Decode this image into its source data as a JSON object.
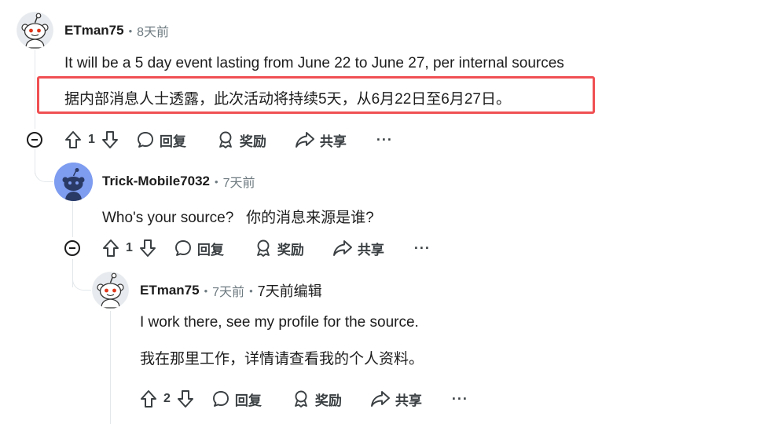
{
  "comments": [
    {
      "username": "ETman75",
      "time": "8天前",
      "text_en": "It will be a 5 day event lasting from June 22 to June 27, per internal sources",
      "text_zh": "据内部消息人士透露，此次活动将持续5天，从6月22日至6月27日。",
      "votes": "1",
      "highlight_color": "#f05053"
    },
    {
      "username": "Trick-Mobile7032",
      "time": "7天前",
      "text": "Who's your source?   你的消息来源是谁?",
      "votes": "1",
      "avatar_color": "#7e9cf0"
    },
    {
      "username": "ETman75",
      "time": "7天前",
      "edited": "7天前编辑",
      "text_en": "I work there, see my profile for the source.",
      "text_zh": "我在那里工作，详情请查看我的个人资料。",
      "votes": "2"
    }
  ],
  "actions": {
    "reply": "回复",
    "award": "奖励",
    "share": "共享",
    "more": "···"
  },
  "icons": [
    "upvote-icon",
    "downvote-icon",
    "reply-icon",
    "award-icon",
    "share-icon",
    "collapse-icon"
  ]
}
